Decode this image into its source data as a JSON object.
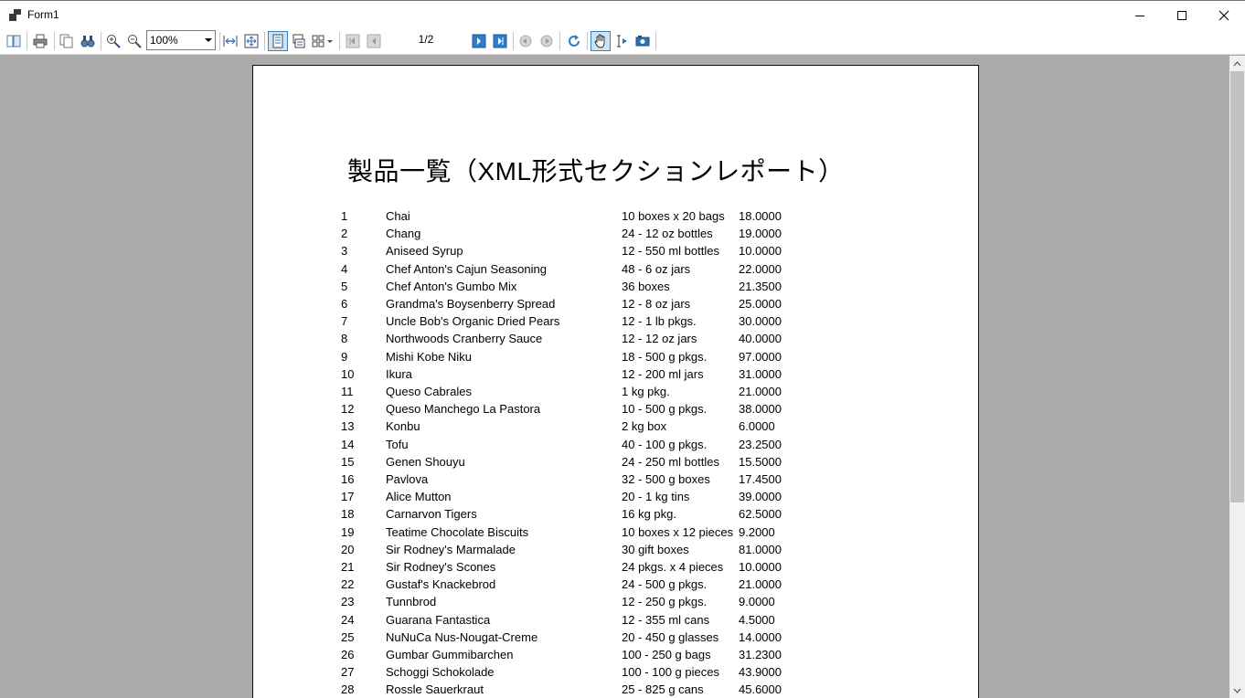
{
  "window": {
    "title": "Form1"
  },
  "toolbar": {
    "zoom_value": "100%",
    "page_indicator": "1/2"
  },
  "report": {
    "title": "製品一覧（XML形式セクションレポート）",
    "rows": [
      {
        "id": "1",
        "name": "Chai",
        "qty": "10 boxes x 20 bags",
        "price": "18.0000"
      },
      {
        "id": "2",
        "name": "Chang",
        "qty": "24 - 12 oz bottles",
        "price": "19.0000"
      },
      {
        "id": "3",
        "name": "Aniseed Syrup",
        "qty": "12 - 550 ml bottles",
        "price": "10.0000"
      },
      {
        "id": "4",
        "name": "Chef Anton's Cajun Seasoning",
        "qty": "48 - 6 oz jars",
        "price": "22.0000"
      },
      {
        "id": "5",
        "name": "Chef Anton's Gumbo Mix",
        "qty": "36 boxes",
        "price": "21.3500"
      },
      {
        "id": "6",
        "name": "Grandma's Boysenberry Spread",
        "qty": "12 - 8 oz jars",
        "price": "25.0000"
      },
      {
        "id": "7",
        "name": "Uncle Bob's Organic Dried Pears",
        "qty": "12 - 1 lb pkgs.",
        "price": "30.0000"
      },
      {
        "id": "8",
        "name": "Northwoods Cranberry Sauce",
        "qty": "12 - 12 oz jars",
        "price": "40.0000"
      },
      {
        "id": "9",
        "name": "Mishi Kobe Niku",
        "qty": "18 - 500 g pkgs.",
        "price": "97.0000"
      },
      {
        "id": "10",
        "name": "Ikura",
        "qty": "12 - 200 ml jars",
        "price": "31.0000"
      },
      {
        "id": "11",
        "name": "Queso Cabrales",
        "qty": "1 kg pkg.",
        "price": "21.0000"
      },
      {
        "id": "12",
        "name": "Queso Manchego La Pastora",
        "qty": "10 - 500 g pkgs.",
        "price": "38.0000"
      },
      {
        "id": "13",
        "name": "Konbu",
        "qty": "2 kg box",
        "price": "6.0000"
      },
      {
        "id": "14",
        "name": "Tofu",
        "qty": "40 - 100 g pkgs.",
        "price": "23.2500"
      },
      {
        "id": "15",
        "name": "Genen Shouyu",
        "qty": "24 - 250 ml bottles",
        "price": "15.5000"
      },
      {
        "id": "16",
        "name": "Pavlova",
        "qty": "32 - 500 g boxes",
        "price": "17.4500"
      },
      {
        "id": "17",
        "name": "Alice Mutton",
        "qty": "20 - 1 kg tins",
        "price": "39.0000"
      },
      {
        "id": "18",
        "name": "Carnarvon Tigers",
        "qty": "16 kg pkg.",
        "price": "62.5000"
      },
      {
        "id": "19",
        "name": "Teatime Chocolate Biscuits",
        "qty": "10 boxes x 12 pieces",
        "price": "9.2000"
      },
      {
        "id": "20",
        "name": "Sir Rodney's Marmalade",
        "qty": "30 gift boxes",
        "price": "81.0000"
      },
      {
        "id": "21",
        "name": "Sir Rodney's Scones",
        "qty": "24 pkgs. x 4 pieces",
        "price": "10.0000"
      },
      {
        "id": "22",
        "name": "Gustaf's Knackebrod",
        "qty": "24 - 500 g pkgs.",
        "price": "21.0000"
      },
      {
        "id": "23",
        "name": "Tunnbrod",
        "qty": "12 - 250 g pkgs.",
        "price": "9.0000"
      },
      {
        "id": "24",
        "name": "Guarana Fantastica",
        "qty": "12 - 355 ml cans",
        "price": "4.5000"
      },
      {
        "id": "25",
        "name": "NuNuCa Nus-Nougat-Creme",
        "qty": "20 - 450 g glasses",
        "price": "14.0000"
      },
      {
        "id": "26",
        "name": "Gumbar Gummibarchen",
        "qty": "100 - 250 g bags",
        "price": "31.2300"
      },
      {
        "id": "27",
        "name": "Schoggi Schokolade",
        "qty": "100 - 100 g pieces",
        "price": "43.9000"
      },
      {
        "id": "28",
        "name": "Rossle Sauerkraut",
        "qty": "25 - 825 g cans",
        "price": "45.6000"
      }
    ]
  }
}
